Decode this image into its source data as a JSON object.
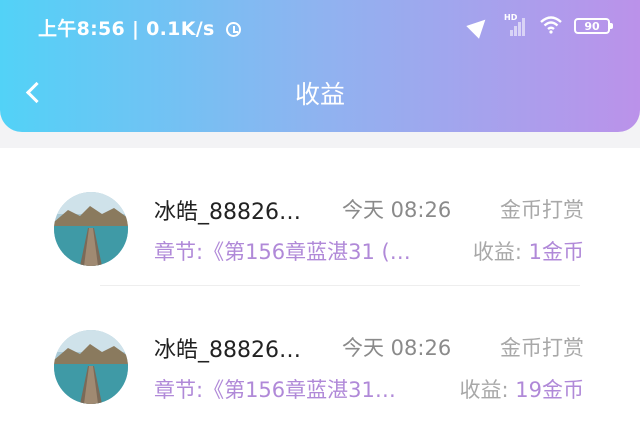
{
  "status_bar": {
    "time": "上午8:56",
    "speed": "0.1K/s",
    "network": "HD",
    "battery": "90"
  },
  "nav": {
    "title": "收益"
  },
  "records": [
    {
      "name": "冰皓_88826…",
      "time": "今天 08:26",
      "type": "金币打赏",
      "chapter": "章节:《第156章蓝湛31 (…",
      "earn_label": "收益:",
      "earn_value": "1金币"
    },
    {
      "name": "冰皓_88826…",
      "time": "今天 08:26",
      "type": "金币打赏",
      "chapter": "章节:《第156章蓝湛31…",
      "earn_label": "收益:",
      "earn_value": "19金币"
    }
  ],
  "colors": {
    "header_start": "#52d2f7",
    "header_end": "#bb92ea",
    "accent_purple": "#b089d8"
  }
}
